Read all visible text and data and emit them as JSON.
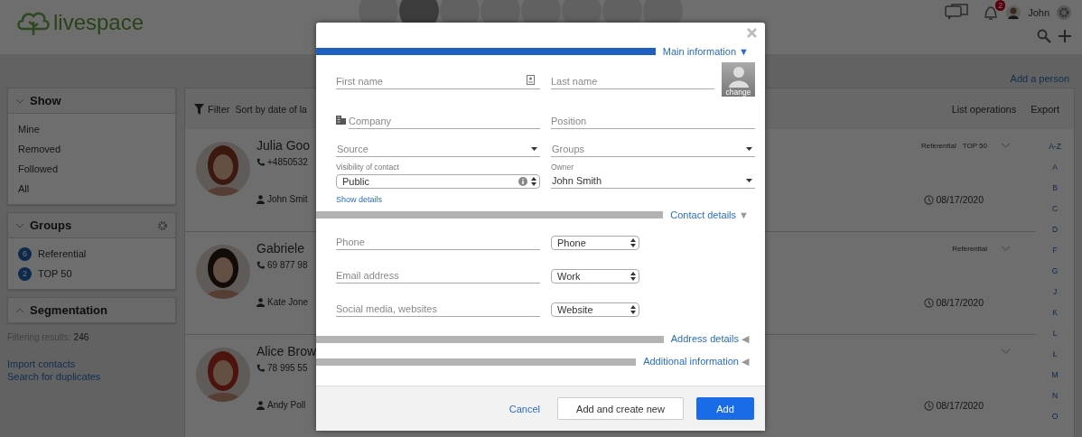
{
  "header": {
    "logo": "livespace",
    "nav": [
      {
        "selected": false
      },
      {
        "selected": true
      },
      {
        "selected": false
      },
      {
        "selected": false
      },
      {
        "selected": false
      },
      {
        "selected": false
      },
      {
        "selected": false
      },
      {
        "selected": false
      }
    ],
    "notifications": "2",
    "user": "John"
  },
  "toolbar": {
    "add_person": "Add a person"
  },
  "sidebar": {
    "show": {
      "title": "Show",
      "items": [
        "Mine",
        "Removed",
        "Followed",
        "All"
      ]
    },
    "groups": {
      "title": "Groups",
      "items": [
        {
          "count": "6",
          "label": "Referential"
        },
        {
          "count": "2",
          "label": "TOP 50"
        }
      ]
    },
    "segmentation": {
      "title": "Segmentation"
    },
    "filtering_label": "Filtering results:",
    "filtering_value": "246",
    "links": [
      "Import contacts",
      "Search for duplicates"
    ]
  },
  "list": {
    "filter": "Filter",
    "sort": "Sort by date of la",
    "actions": [
      "List operations",
      "Export"
    ],
    "contacts": [
      {
        "name": "Julia Goo",
        "phone": "+4850532",
        "owner": "John Smit",
        "tags": [
          "Referential",
          "TOP 50"
        ],
        "date": "08/17/2020"
      },
      {
        "name": "Gabriele",
        "phone": "69 877 98",
        "owner": "Kate Jone",
        "tags": [
          "Referential"
        ],
        "date": "08/17/2020"
      },
      {
        "name": "Alice Brow",
        "phone": "78 995 55",
        "owner": "Andy Poll",
        "date": "08/17/2020"
      }
    ],
    "alphabet": [
      "A-Z",
      "A",
      "B",
      "C",
      "D",
      "F",
      "G",
      "J",
      "K",
      "L",
      "Ł",
      "M",
      "N",
      "O"
    ]
  },
  "modal": {
    "main_section": {
      "title": "Main information",
      "arrow": "▼",
      "active": true
    },
    "first_name": {
      "placeholder": "First name"
    },
    "last_name": {
      "placeholder": "Last name"
    },
    "photo": {
      "label": "change"
    },
    "company": {
      "placeholder": "Company"
    },
    "position": {
      "placeholder": "Position"
    },
    "source": {
      "placeholder": "Source"
    },
    "groups": {
      "placeholder": "Groups"
    },
    "visibility": {
      "label": "Visibility of contact",
      "value": "Public"
    },
    "owner": {
      "label": "Owner",
      "value": "John Smith"
    },
    "show_details": "Show details",
    "contact_section": {
      "title": "Contact details",
      "arrow": "▼",
      "active": false,
      "rows": [
        {
          "placeholder": "Phone",
          "type": "Phone"
        },
        {
          "placeholder": "Email address",
          "type": "Work"
        },
        {
          "placeholder": "Social media, websites",
          "type": "Website"
        }
      ]
    },
    "collapsed_sections": [
      {
        "title": "Address details",
        "arrow": "◀",
        "active": false
      },
      {
        "title": "Additional information",
        "arrow": "◀",
        "active": false
      }
    ],
    "cancel": "Cancel",
    "secondary": "Add and create new",
    "primary": "Add"
  }
}
